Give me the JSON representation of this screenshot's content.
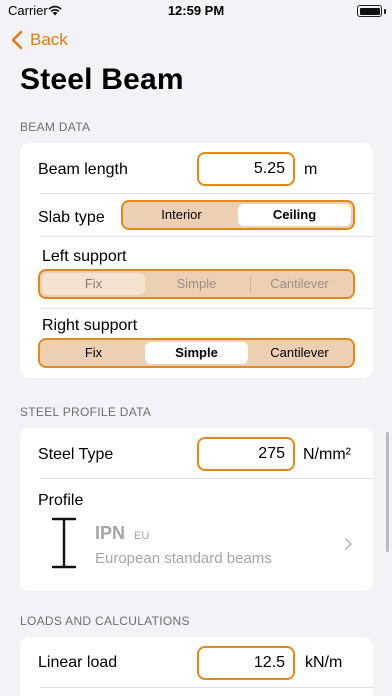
{
  "status_bar": {
    "carrier": "Carrier",
    "time": "12:59 PM",
    "battery_level": 1.0
  },
  "nav": {
    "back_label": "Back"
  },
  "page": {
    "title": "Steel Beam"
  },
  "accent_color": "#e08a1e",
  "beam_data": {
    "header": "BEAM DATA",
    "beam_length": {
      "label": "Beam length",
      "value": "5.25",
      "unit": "m"
    },
    "slab_type": {
      "label": "Slab type",
      "options": [
        "Interior",
        "Ceiling"
      ],
      "selected": "Ceiling"
    },
    "left_support": {
      "label": "Left support",
      "options": [
        "Fix",
        "Simple",
        "Cantilever"
      ],
      "selected": "Fix"
    },
    "right_support": {
      "label": "Right support",
      "options": [
        "Fix",
        "Simple",
        "Cantilever"
      ],
      "selected": "Simple"
    }
  },
  "steel_profile": {
    "header": "STEEL PROFILE DATA",
    "steel_type": {
      "label": "Steel Type",
      "value": "275",
      "unit": "N/mm²"
    },
    "profile": {
      "label": "Profile",
      "icon": "i-beam-icon",
      "code": "IPN",
      "region": "EU",
      "description": "European standard beams"
    }
  },
  "loads": {
    "header": "LOADS AND CALCULATIONS",
    "linear_load": {
      "label": "Linear load",
      "value": "12.5",
      "unit": "kN/m"
    }
  }
}
